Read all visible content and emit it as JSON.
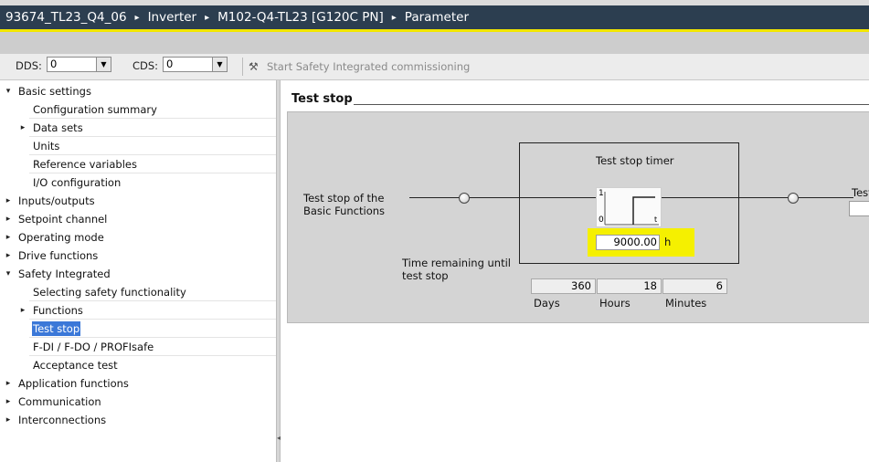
{
  "breadcrumb": {
    "items": [
      "93674_TL23_Q4_06",
      "Inverter",
      "M102-Q4-TL23 [G120C PN]",
      "Parameter"
    ],
    "separator": "▸"
  },
  "toolbar": {
    "dds_label": "DDS:",
    "dds_value": "0",
    "cds_label": "CDS:",
    "cds_value": "0",
    "start_commissioning_label": "Start Safety Integrated commissioning",
    "dropdown_glyph": "▼",
    "tools_glyph": "⚒"
  },
  "nav": {
    "items": [
      {
        "label": "Basic settings",
        "expander": "▾"
      },
      {
        "label": "Configuration summary",
        "expander": ""
      },
      {
        "label": "Data sets",
        "expander": "▸"
      },
      {
        "label": "Units",
        "expander": ""
      },
      {
        "label": "Reference variables",
        "expander": ""
      },
      {
        "label": "I/O configuration",
        "expander": ""
      },
      {
        "label": "Inputs/outputs",
        "expander": "▸"
      },
      {
        "label": "Setpoint channel",
        "expander": "▸"
      },
      {
        "label": "Operating mode",
        "expander": "▸"
      },
      {
        "label": "Drive functions",
        "expander": "▸"
      },
      {
        "label": "Safety Integrated",
        "expander": "▾"
      },
      {
        "label": "Selecting safety functionality",
        "expander": ""
      },
      {
        "label": "Functions",
        "expander": "▸"
      },
      {
        "label": "Test stop",
        "expander": "",
        "selected": true
      },
      {
        "label": "F-DI / F-DO / PROFIsafe",
        "expander": ""
      },
      {
        "label": "Acceptance test",
        "expander": ""
      },
      {
        "label": "Application functions",
        "expander": "▸"
      },
      {
        "label": "Communication",
        "expander": "▸"
      },
      {
        "label": "Interconnections",
        "expander": "▸"
      }
    ],
    "selected_color": "#3b78d8"
  },
  "splitter_grip": "◂",
  "main": {
    "section_title": "Test stop",
    "input_label_line1": "Test stop of the",
    "input_label_line2": "Basic Functions",
    "timer_title": "Test stop timer",
    "signal_high": "1",
    "signal_low": "0",
    "signal_t": "t",
    "timer_value": "9000.00",
    "timer_unit": "h",
    "highlight_color": "#f5f000",
    "remaining_label_line1": "Time remaining until",
    "remaining_label_line2": "test stop",
    "remaining": [
      {
        "value": "360",
        "unit": "Days"
      },
      {
        "value": "18",
        "unit": "Hours"
      },
      {
        "value": "6",
        "unit": "Minutes"
      }
    ],
    "right_label": "Test"
  }
}
